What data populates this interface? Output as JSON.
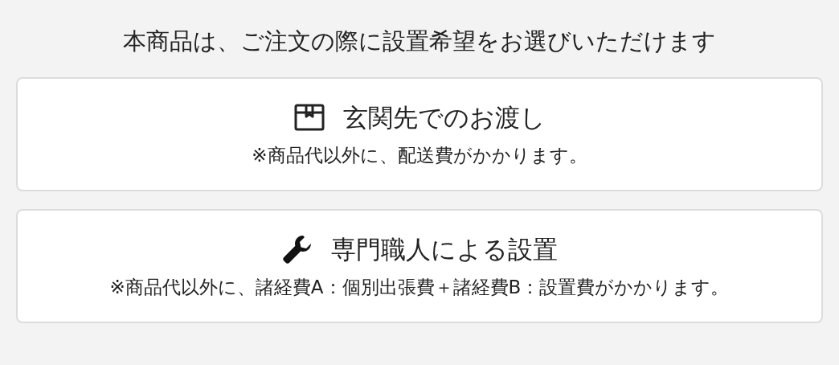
{
  "heading": "本商品は、ご注文の際に設置希望をお選びいただけます",
  "options": [
    {
      "kind": "box",
      "title": "玄関先でのお渡し",
      "note": "※商品代以外に、配送費がかかります。"
    },
    {
      "kind": "wrench",
      "title": "専門職人による設置",
      "note": "※商品代以外に、諸経費A：個別出張費＋諸経費B：設置費がかかります。"
    }
  ]
}
